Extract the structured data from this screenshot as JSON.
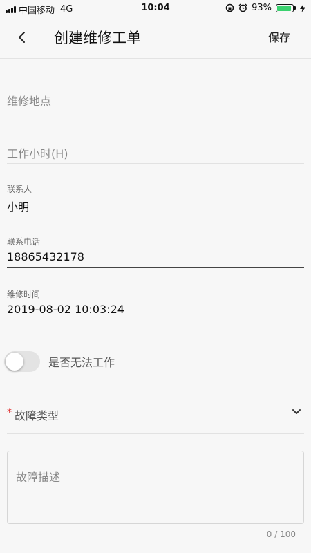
{
  "status_bar": {
    "carrier": "中国移动",
    "network": "4G",
    "time": "10:04",
    "battery_percent_text": "93%",
    "battery_level": 0.93,
    "battery_color": "#3bd16f"
  },
  "header": {
    "title": "创建维修工单",
    "save_label": "保存",
    "back_icon": "chevron-left-icon"
  },
  "form": {
    "location": {
      "placeholder": "维修地点"
    },
    "work_hours": {
      "placeholder": "工作小时(H)"
    },
    "contact": {
      "label": "联系人",
      "value": "小明"
    },
    "phone": {
      "label": "联系电话",
      "value": "18865432178"
    },
    "repair_time": {
      "label": "维修时间",
      "value": "2019-08-02 10:03:24"
    },
    "unable_to_work": {
      "label": "是否无法工作",
      "checked": false
    },
    "fault_type": {
      "required_mark": "*",
      "label": "故障类型"
    },
    "fault_description": {
      "placeholder": "故障描述",
      "count": "0 / 100"
    }
  },
  "colors": {
    "required": "#e03131",
    "toggle_off": "#e3e3e3",
    "background": "#f7f7f7"
  }
}
